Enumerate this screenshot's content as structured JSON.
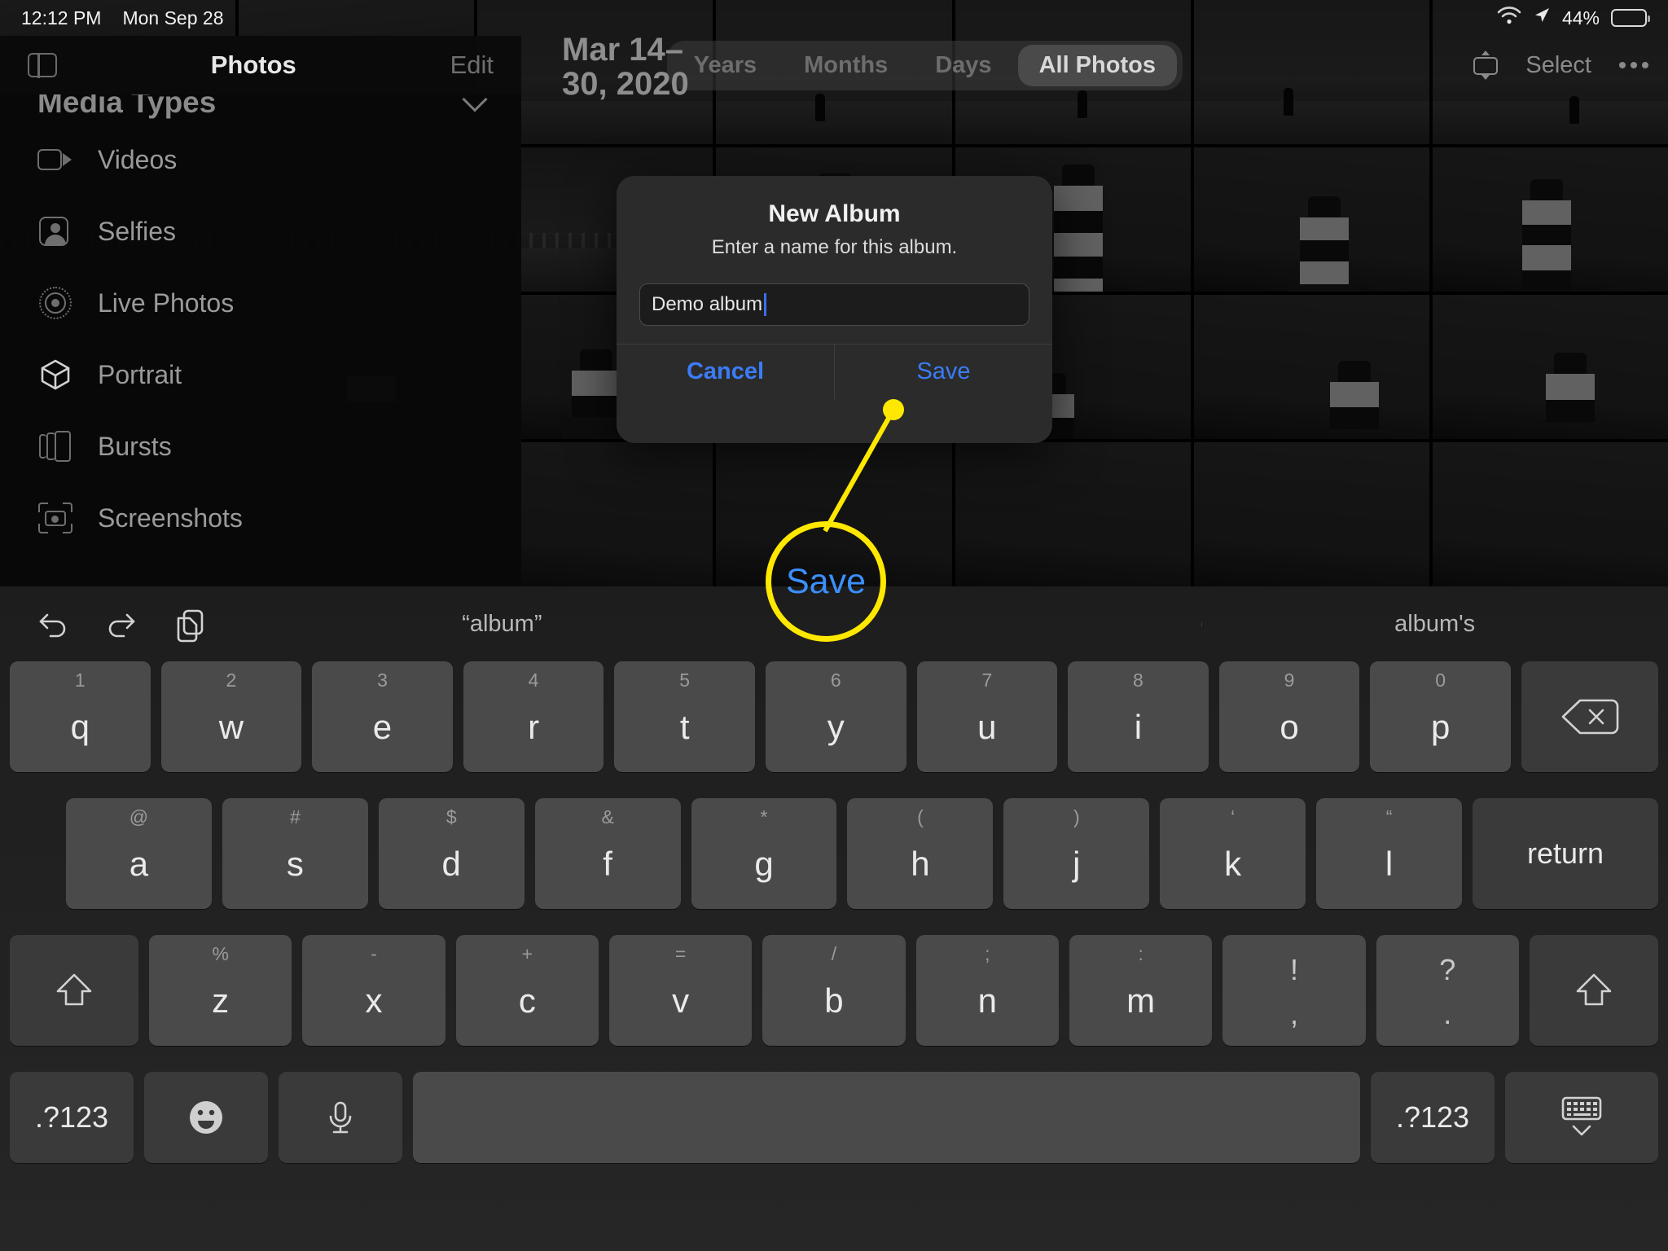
{
  "status_bar": {
    "time": "12:12 PM",
    "date": "Mon Sep 28",
    "battery_percent": "44%",
    "wifi_icon": "wifi-icon",
    "location_icon": "location-arrow-icon",
    "battery_icon": "battery-icon"
  },
  "navbar": {
    "sidebar_toggle_icon": "sidebar-toggle-icon",
    "title": "Photos",
    "edit_label": "Edit",
    "date_range": "Mar 14–30, 2020",
    "segments": [
      {
        "label": "Years",
        "active": false
      },
      {
        "label": "Months",
        "active": false
      },
      {
        "label": "Days",
        "active": false
      },
      {
        "label": "All Photos",
        "active": true
      }
    ],
    "airplay_icon": "airplay-icon",
    "select_label": "Select",
    "more_icon": "ellipsis-icon"
  },
  "sidebar": {
    "section_label": "Media Types",
    "chevron_icon": "chevron-down-icon",
    "items": [
      {
        "label": "Videos",
        "icon": "video-icon"
      },
      {
        "label": "Selfies",
        "icon": "selfie-person-icon"
      },
      {
        "label": "Live Photos",
        "icon": "live-photo-icon"
      },
      {
        "label": "Portrait",
        "icon": "cube-icon"
      },
      {
        "label": "Bursts",
        "icon": "bursts-stack-icon"
      },
      {
        "label": "Screenshots",
        "icon": "screenshot-camera-icon"
      }
    ]
  },
  "dialog": {
    "title": "New Album",
    "subtitle": "Enter a name for this album.",
    "input_value": "Demo album",
    "input_placeholder": "",
    "cancel_label": "Cancel",
    "save_label": "Save"
  },
  "annotation": {
    "label": "Save",
    "circle_color": "#ffe800",
    "label_color": "#3b8ffb"
  },
  "keyboard": {
    "tools": [
      {
        "icon": "undo-icon"
      },
      {
        "icon": "redo-icon"
      },
      {
        "icon": "paste-icon"
      }
    ],
    "predictions": [
      "“album”",
      "",
      "album's"
    ],
    "row1": [
      {
        "main": "q",
        "sec": "1"
      },
      {
        "main": "w",
        "sec": "2"
      },
      {
        "main": "e",
        "sec": "3"
      },
      {
        "main": "r",
        "sec": "4"
      },
      {
        "main": "t",
        "sec": "5"
      },
      {
        "main": "y",
        "sec": "6"
      },
      {
        "main": "u",
        "sec": "7"
      },
      {
        "main": "i",
        "sec": "8"
      },
      {
        "main": "o",
        "sec": "9"
      },
      {
        "main": "p",
        "sec": "0"
      }
    ],
    "backspace_icon": "backspace-icon",
    "row2": [
      {
        "main": "a",
        "sec": "@"
      },
      {
        "main": "s",
        "sec": "#"
      },
      {
        "main": "d",
        "sec": "$"
      },
      {
        "main": "f",
        "sec": "&"
      },
      {
        "main": "g",
        "sec": "*"
      },
      {
        "main": "h",
        "sec": "("
      },
      {
        "main": "j",
        "sec": ")"
      },
      {
        "main": "k",
        "sec": "‘"
      },
      {
        "main": "l",
        "sec": "“"
      }
    ],
    "return_label": "return",
    "row3": [
      {
        "main": "z",
        "sec": "%"
      },
      {
        "main": "x",
        "sec": "-"
      },
      {
        "main": "c",
        "sec": "+"
      },
      {
        "main": "v",
        "sec": "="
      },
      {
        "main": "b",
        "sec": "/"
      },
      {
        "main": "n",
        "sec": ";"
      },
      {
        "main": "m",
        "sec": ":"
      }
    ],
    "punct_keys": [
      {
        "top": "!",
        "bottom": ","
      },
      {
        "top": "?",
        "bottom": "."
      }
    ],
    "shift_left_icon": "shift-arrow-icon",
    "shift_right_icon": "shift-arrow-icon",
    "numbers_left_label": ".?123",
    "numbers_right_label": ".?123",
    "emoji_icon": "emoji-smiley-icon",
    "mic_icon": "microphone-icon",
    "space_label": "",
    "dismiss_icon": "dismiss-keyboard-icon"
  }
}
